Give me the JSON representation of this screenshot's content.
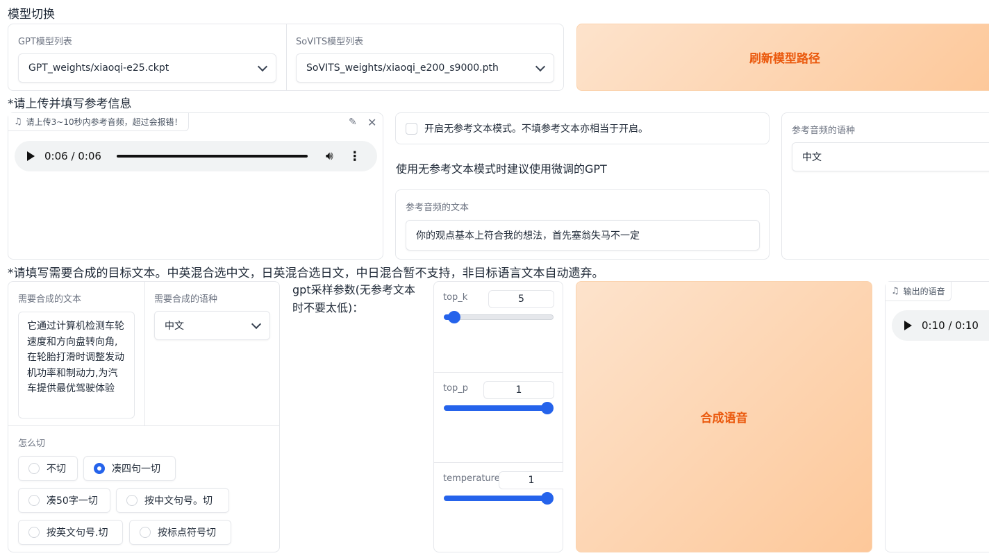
{
  "model_switch": {
    "heading": "模型切换",
    "gpt_label": "GPT模型列表",
    "gpt_value": "GPT_weights/xiaoqi-e25.ckpt",
    "sovits_label": "SoVITS模型列表",
    "sovits_value": "SoVITS_weights/xiaoqi_e200_s9000.pth",
    "refresh_button": "刷新模型路径"
  },
  "reference": {
    "heading": "*请上传并填写参考信息",
    "audio_tag": "请上传3~10秒内参考音频，超过会报错！",
    "audio_time": "0:06 / 0:06",
    "no_ref_checkbox": "开启无参考文本模式。不填参考文本亦相当于开启。",
    "no_ref_hint": "使用无参考文本模式时建议使用微调的GPT",
    "ref_text_label": "参考音频的文本",
    "ref_text_value": "你的观点基本上符合我的想法，首先塞翁失马不一定",
    "ref_lang_label": "参考音频的语种",
    "ref_lang_value": "中文"
  },
  "synthesis": {
    "heading": "*请填写需要合成的目标文本。中英混合选中文，日英混合选日文，中日混合暂不支持，非目标语言文本自动遗弃。",
    "target_text_label": "需要合成的文本",
    "target_text_value": "它通过计算机检测车轮速度和方向盘转向角,在轮胎打滑时调整发动机功率和制动力,为汽车提供最优驾驶体验",
    "target_lang_label": "需要合成的语种",
    "target_lang_value": "中文",
    "cut_label": "怎么切",
    "cut_options": [
      "不切",
      "凑四句一切",
      "凑50字一切",
      "按中文句号。切",
      "按英文句号.切",
      "按标点符号切"
    ],
    "gpt_params_label": "gpt采样参数(无参考文本时不要太低)：",
    "top_k_label": "top_k",
    "top_k_value": "5",
    "top_p_label": "top_p",
    "top_p_value": "1",
    "temperature_label": "temperature",
    "temperature_value": "1",
    "synth_button": "合成语音",
    "output_tag": "输出的语音",
    "output_time": "0:10 / 0:10"
  },
  "sliders": {
    "top_k_fraction": 0.04,
    "top_p_fraction": 1.0,
    "temperature_fraction": 1.0
  },
  "colors": {
    "accent": "#2563eb",
    "button_text": "#ea580c",
    "button_from": "#fde3cc",
    "button_to": "#fdc89a"
  }
}
